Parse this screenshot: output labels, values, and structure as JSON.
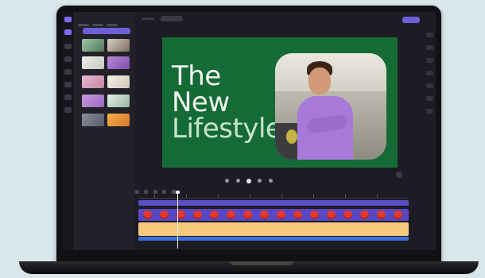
{
  "preview": {
    "title_lines": [
      "The",
      "New",
      "Lifestyle"
    ]
  },
  "colors": {
    "accent": "#6d5fd8",
    "preview_background": "#156b35",
    "video_track": "#5848c6",
    "audio_track": "#f7c97a",
    "overlay_track": "#3e6fd8"
  },
  "icons": {
    "left_rail": [
      "home-icon",
      "media-icon",
      "text-icon",
      "effects-icon",
      "transitions-icon",
      "filters-icon",
      "brand-kit-icon",
      "templates-icon"
    ],
    "right_rail": [
      "captions-icon",
      "audio-icon",
      "fade-icon",
      "filters-icon",
      "effects-icon",
      "adjust-icon",
      "speed-icon"
    ],
    "transport": [
      "skip-back-icon",
      "rewind-icon",
      "play-icon",
      "forward-icon",
      "skip-forward-icon"
    ]
  }
}
